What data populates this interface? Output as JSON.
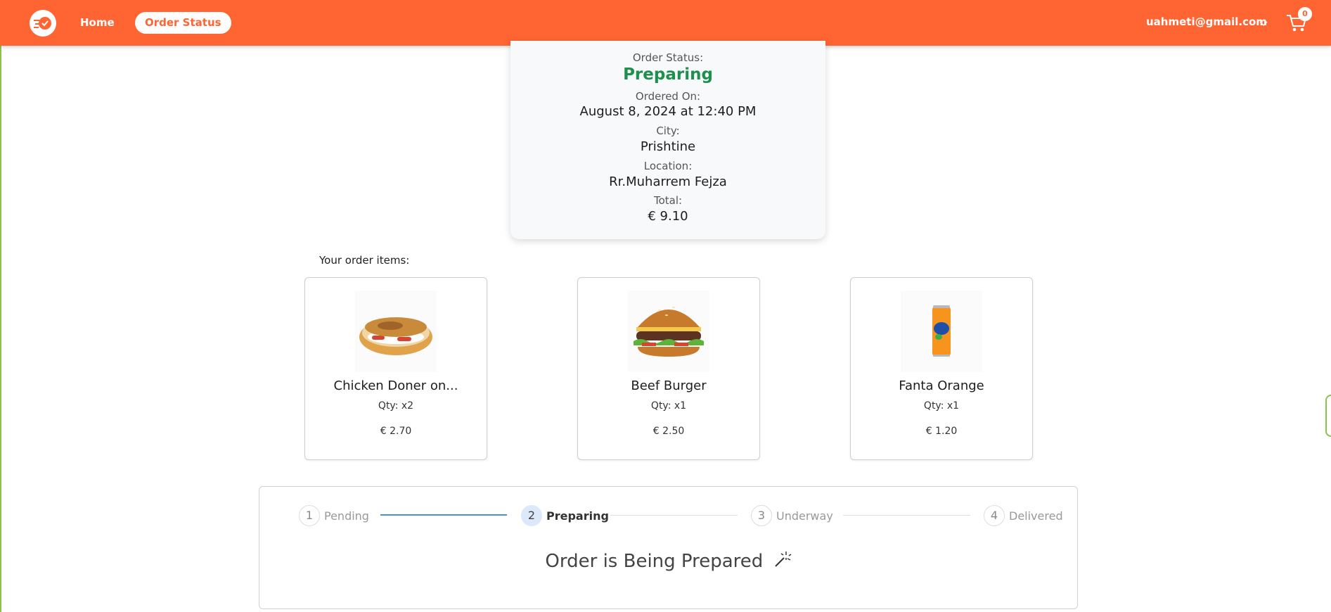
{
  "nav": {
    "home_label": "Home",
    "order_status_label": "Order Status",
    "user_email": "uahmeti@gmail.com",
    "cart_count": "0"
  },
  "order": {
    "status_label": "Order Status:",
    "status_value": "Preparing",
    "ordered_on_label": "Ordered On:",
    "ordered_on_value": "August 8, 2024 at 12:40 PM",
    "city_label": "City:",
    "city_value": "Prishtine",
    "location_label": "Location:",
    "location_value": "Rr.Muharrem Fejza",
    "total_label": "Total:",
    "total_value": "€ 9.10"
  },
  "items_title": "Your order items:",
  "items": [
    {
      "name": "Chicken Doner on...",
      "qty": "Qty: x2",
      "price": "€ 2.70",
      "image": "doner-image"
    },
    {
      "name": "Beef Burger",
      "qty": "Qty: x1",
      "price": "€ 2.50",
      "image": "burger-image"
    },
    {
      "name": "Fanta Orange",
      "qty": "Qty: x1",
      "price": "€ 1.20",
      "image": "fanta-can-image"
    }
  ],
  "steps": [
    {
      "num": "1",
      "label": "Pending"
    },
    {
      "num": "2",
      "label": "Preparing"
    },
    {
      "num": "3",
      "label": "Underway"
    },
    {
      "num": "4",
      "label": "Delivered"
    }
  ],
  "active_step": 2,
  "progress_message": "Order is Being Prepared",
  "colors": {
    "brand": "#ff6433",
    "status_green": "#1f8f4e",
    "step_active_bg": "#dce9fb",
    "connector_done": "#4a90e2"
  }
}
